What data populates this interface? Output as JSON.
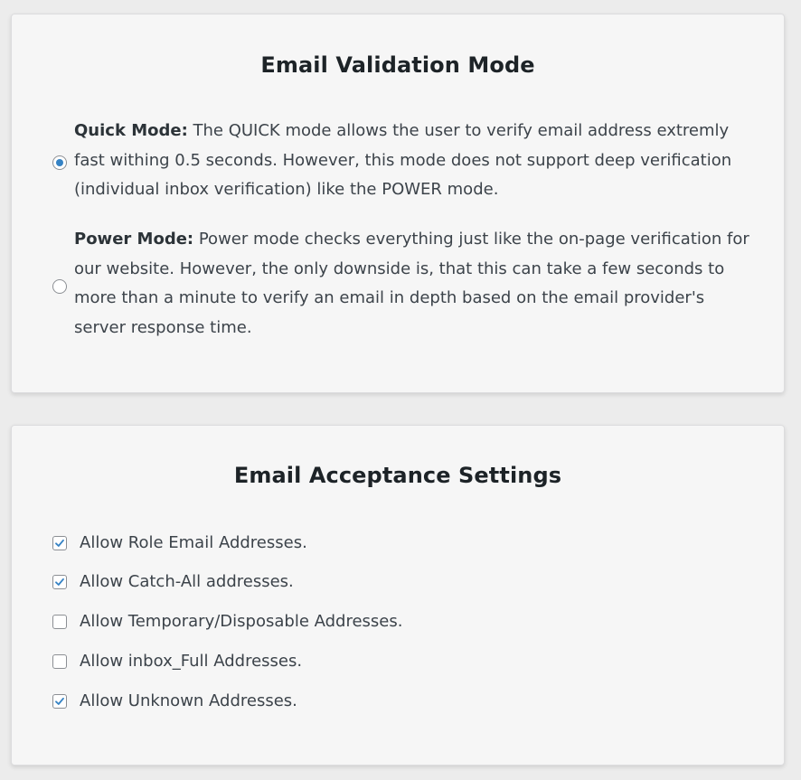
{
  "validation": {
    "title": "Email Validation Mode",
    "options": [
      {
        "name": "Quick Mode:",
        "description": "The QUICK mode allows the user to verify email address extremly fast withing 0.5 seconds. However, this mode does not support deep verification (individual inbox verification) like the POWER mode.",
        "selected": true
      },
      {
        "name": "Power Mode:",
        "description": "Power mode checks everything just like the on-page verification for our website. However, the only downside is, that this can take a few seconds to more than a minute to verify an email in depth based on the email provider's server response time.",
        "selected": false
      }
    ]
  },
  "acceptance": {
    "title": "Email Acceptance Settings",
    "items": [
      {
        "label": "Allow Role Email Addresses.",
        "checked": true
      },
      {
        "label": "Allow Catch-All addresses.",
        "checked": true
      },
      {
        "label": "Allow Temporary/Disposable Addresses.",
        "checked": false
      },
      {
        "label": "Allow inbox_Full Addresses.",
        "checked": false
      },
      {
        "label": "Allow Unknown Addresses.",
        "checked": true
      }
    ]
  },
  "colors": {
    "accent": "#3582c4",
    "card_background": "#f6f6f6",
    "page_background": "#ececec"
  }
}
